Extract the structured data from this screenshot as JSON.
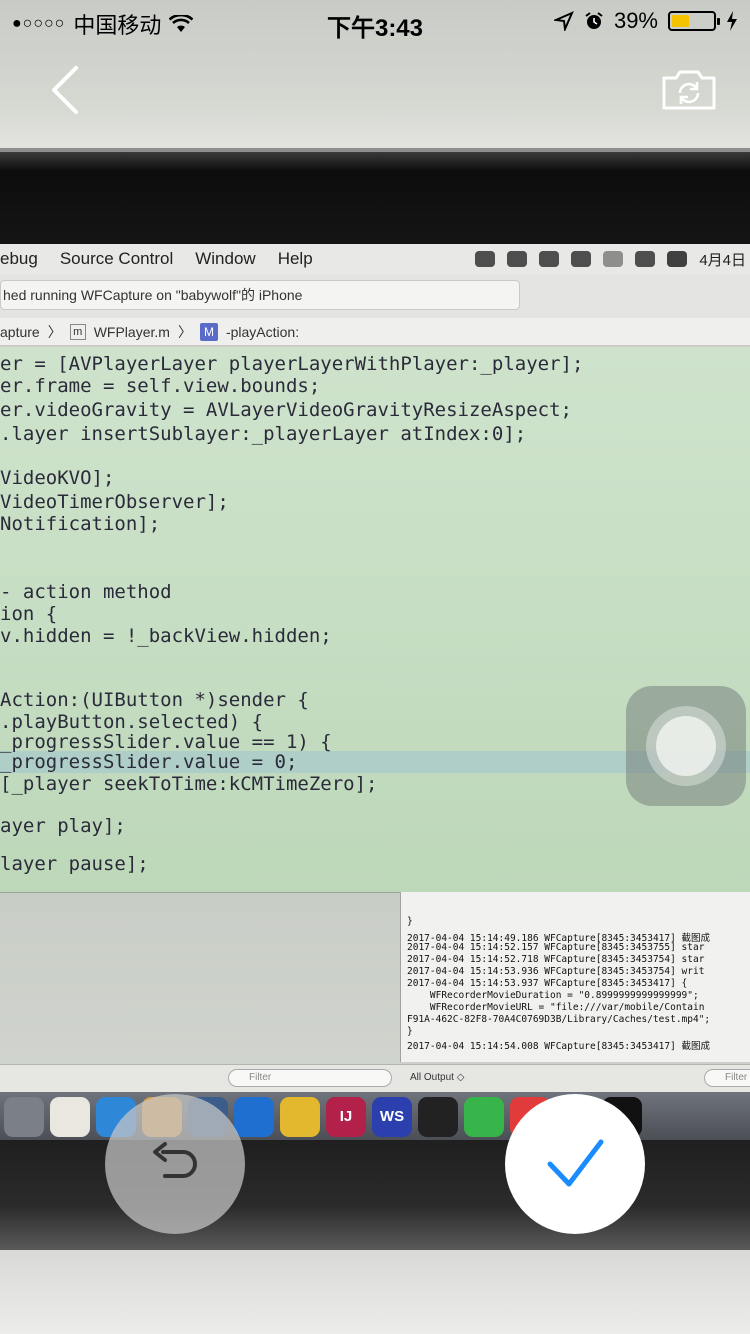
{
  "status_bar": {
    "signal": "●○○○○",
    "carrier": "中国移动",
    "time": "下午3:43",
    "battery": "39%",
    "battery_color": "#f5c400"
  },
  "camera_controls": {
    "back_icon": "chevron-left-icon",
    "switch_icon": "camera-switch-icon",
    "retake_icon": "undo-icon",
    "confirm_icon": "checkmark-icon",
    "confirm_color": "#1a8cff"
  },
  "photo": {
    "menubar": {
      "items": [
        "ebug",
        "Source Control",
        "Window",
        "Help"
      ],
      "date": "4月4日"
    },
    "status_message": "hed running WFCapture on \"babywolf\"的 iPhone",
    "jumpbar": {
      "crumb1": "apture",
      "file_badge": "m",
      "file": "WFPlayer.m",
      "method_badge": "M",
      "method": "-playAction:"
    },
    "code_lines": [
      "er = [AVPlayerLayer playerLayerWithPlayer:_player];",
      "er.frame = self.view.bounds;",
      "er.videoGravity = AVLayerVideoGravityResizeAspect;",
      ".layer insertSublayer:_playerLayer atIndex:0];",
      "VideoKVO];",
      "VideoTimerObserver];",
      "Notification];",
      "- action method",
      "ion {",
      "v.hidden = !_backView.hidden;",
      "Action:(UIButton *)sender {",
      ".playButton.selected) {",
      "_progressSlider.value == 1) {",
      "_progressSlider.value = 0;",
      "[_player seekToTime:kCMTimeZero];",
      "ayer play];",
      "layer pause];"
    ],
    "log_lines": [
      "}",
      "2017-04-04 15:14:49.186 WFCapture[8345:3453417] 截图成",
      "2017-04-04 15:14:52.157 WFCapture[8345:3453755] star",
      "2017-04-04 15:14:52.718 WFCapture[8345:3453754] star",
      "2017-04-04 15:14:53.936 WFCapture[8345:3453754] writ",
      "2017-04-04 15:14:53.937 WFCapture[8345:3453417] {",
      "    WFRecorderMovieDuration = \"0.8999999999999999\";",
      "    WFRecorderMovieURL = \"file:///var/mobile/Contain",
      "F91A-462C-82F8-70A4C0769D3B/Library/Caches/test.mp4\";",
      "}",
      "2017-04-04 15:14:54.008 WFCapture[8345:3453417] 截图成"
    ],
    "filter_left": "Filter",
    "all_output": "All Output ◇",
    "filter_right": "Filter",
    "dock_labels": [
      "IJ",
      "WS"
    ]
  }
}
